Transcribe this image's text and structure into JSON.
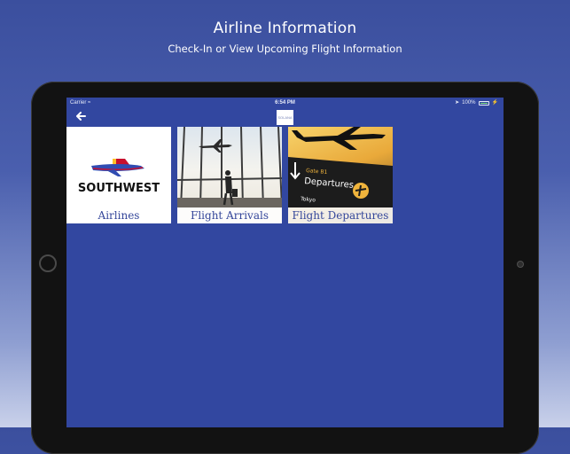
{
  "promo": {
    "title": "Airline Information",
    "subtitle": "Check-In or View Upcoming Flight Information"
  },
  "status_bar": {
    "carrier": "Carrier",
    "time": "6:54 PM",
    "battery": "100%"
  },
  "nav": {
    "back_icon": "back-arrow-icon",
    "logo_text": "SOLANA"
  },
  "tiles": [
    {
      "label": "Airlines",
      "logo_text": "SOUTHWEST"
    },
    {
      "label": "Flight Arrivals"
    },
    {
      "label": "Flight Departures",
      "board_gate": "Gate B1",
      "board_title": "Departures",
      "board_city": "Tokyo"
    }
  ],
  "colors": {
    "screen_bg": "#3247a0",
    "label_text": "#34469a",
    "southwest_blue": "#304cb2",
    "southwest_red": "#c8102e",
    "southwest_yellow": "#ffbf27"
  }
}
